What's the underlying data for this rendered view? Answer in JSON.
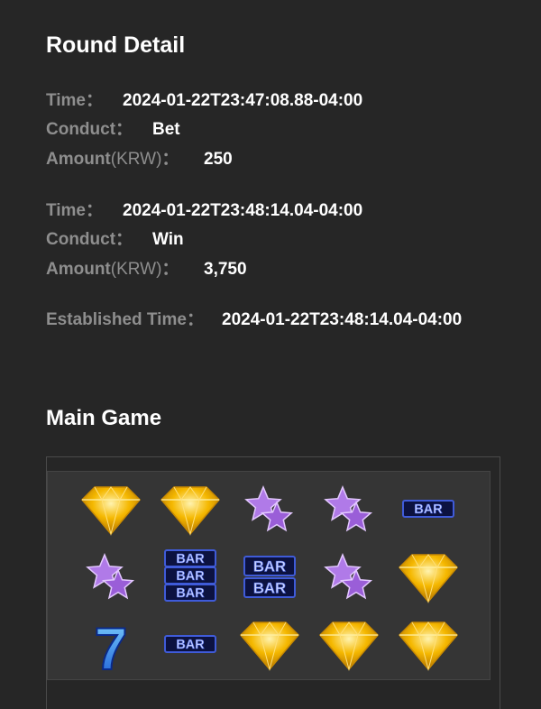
{
  "round_detail": {
    "title": "Round Detail",
    "entries": [
      {
        "time_label": "Time",
        "time_value": "2024-01-22T23:47:08.88-04:00",
        "conduct_label": "Conduct",
        "conduct_value": "Bet",
        "amount_label": "Amount",
        "amount_unit": "(KRW)",
        "amount_value": "250"
      },
      {
        "time_label": "Time",
        "time_value": "2024-01-22T23:48:14.04-04:00",
        "conduct_label": "Conduct",
        "conduct_value": "Win",
        "amount_label": "Amount",
        "amount_unit": "(KRW)",
        "amount_value": "3,750"
      }
    ],
    "established_label": "Established Time",
    "established_value": "2024-01-22T23:48:14.04-04:00",
    "colon": "："
  },
  "main_game": {
    "title": "Main Game",
    "bar_text": "BAR",
    "seven_text": "7",
    "reels": [
      [
        "diamond",
        "purple-star",
        "seven"
      ],
      [
        "diamond",
        "triple-bar",
        "single-bar"
      ],
      [
        "purple-star",
        "double-bar",
        "diamond"
      ],
      [
        "purple-star",
        "purple-star",
        "diamond"
      ],
      [
        "single-bar",
        "diamond",
        "diamond"
      ]
    ]
  },
  "colors": {
    "background": "#262626",
    "label": "#8e8e8e",
    "value": "#ffffff",
    "diamond": "#f5b800",
    "star": "#a86be0",
    "bar": "#3f5bd9"
  }
}
